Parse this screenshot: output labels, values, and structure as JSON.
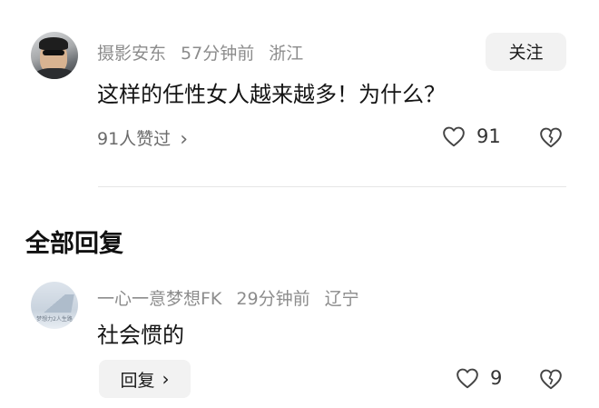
{
  "post": {
    "author": "摄影安东",
    "time": "57分钟前",
    "location": "浙江",
    "follow_label": "关注",
    "text": "这样的任性女人越来越多！为什么？",
    "liked_by": "91人赞过",
    "like_count": "91",
    "icons": {
      "like": "heart-outline-icon",
      "dislike": "broken-heart-icon",
      "chevron": "chevron-right-icon"
    }
  },
  "replies_section": {
    "title": "全部回复"
  },
  "reply": {
    "author": "一心一意梦想FK",
    "time": "29分钟前",
    "location": "辽宁",
    "text": "社会惯的",
    "reply_label": "回复",
    "like_count": "9",
    "avatar_caption": "梦想力2人生路"
  },
  "colors": {
    "meta": "#8c8c8c",
    "button_bg": "#f2f2f2",
    "divider": "#e6e6e6",
    "text": "#141414"
  }
}
